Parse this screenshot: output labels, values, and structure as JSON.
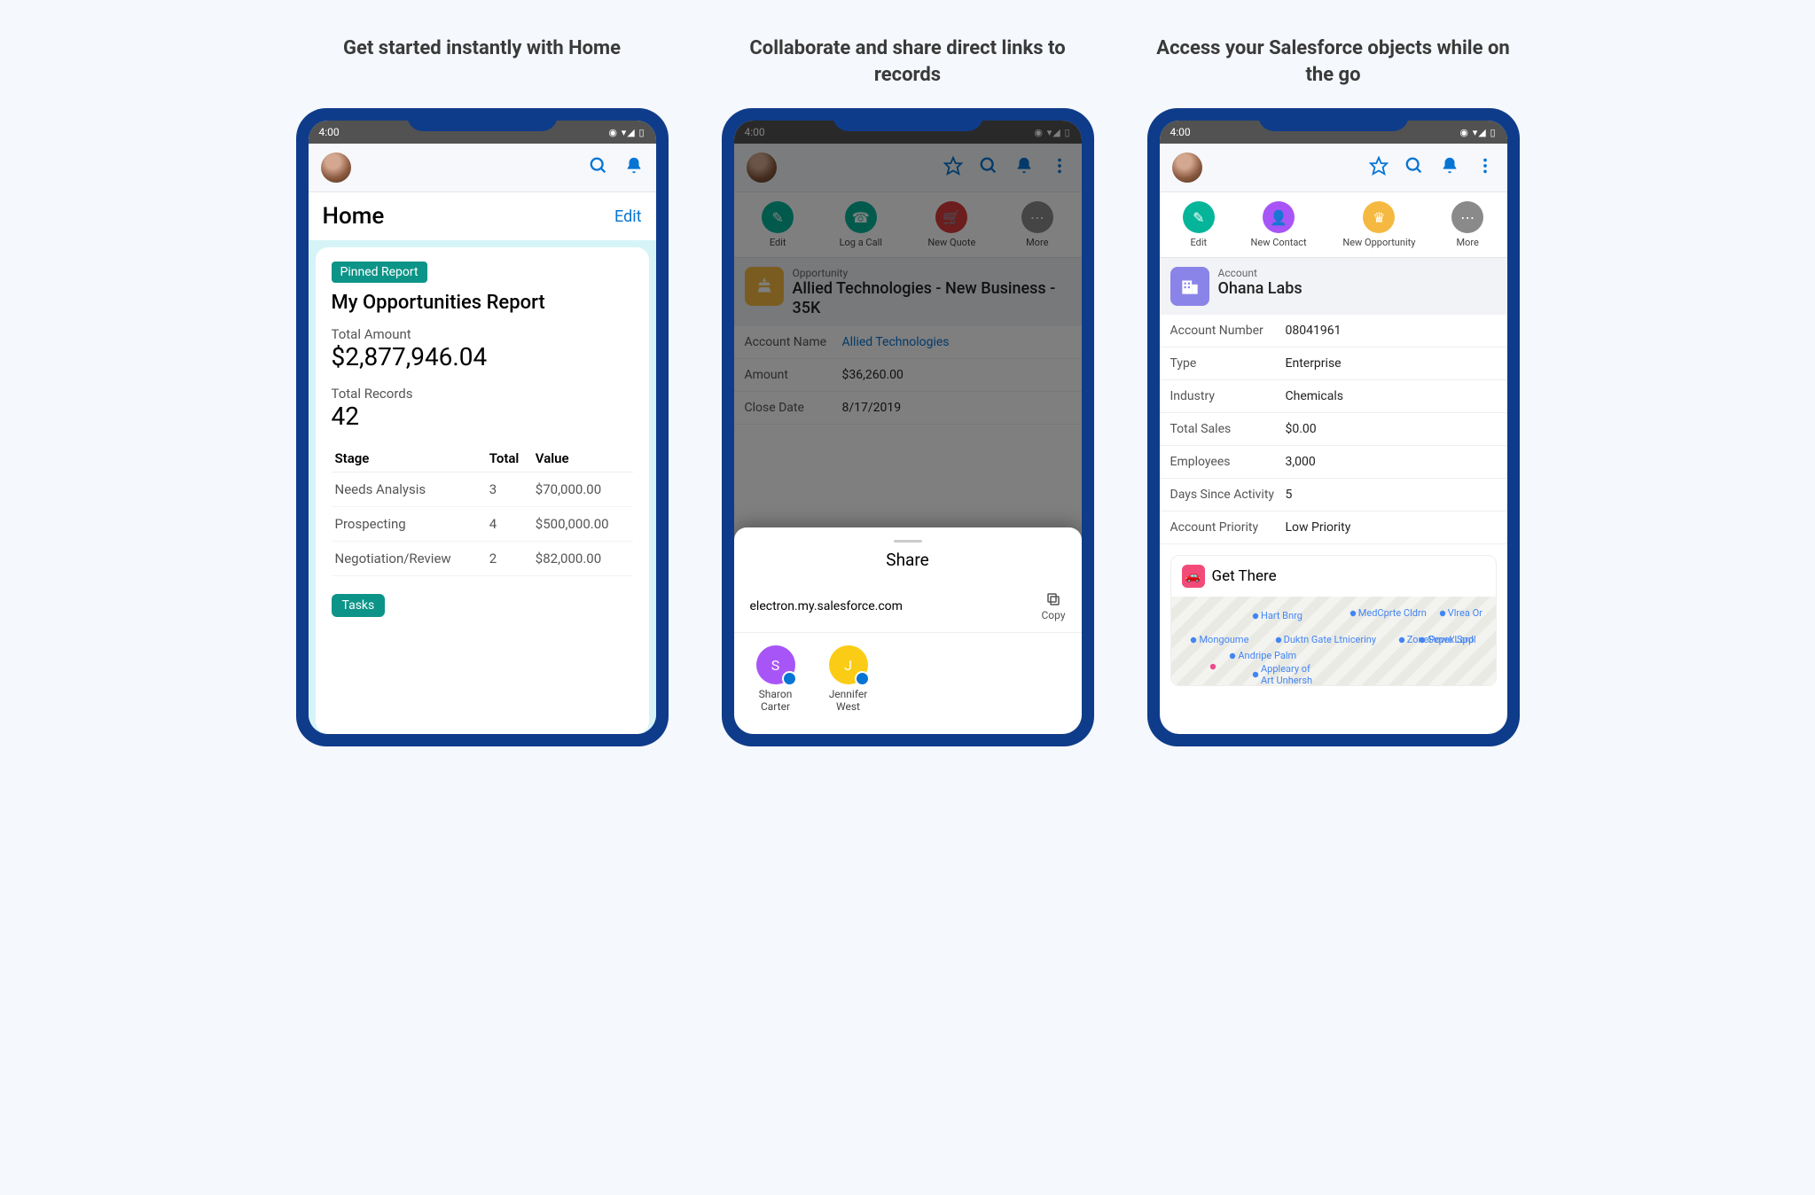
{
  "captions": [
    "Get started instantly with Home",
    "Collaborate and share direct links to records",
    "Access your Salesforce objects while on the go"
  ],
  "status_time": "4:00",
  "phone1": {
    "page_title": "Home",
    "edit": "Edit",
    "pinned_label": "Pinned Report",
    "report_title": "My Opportunities Report",
    "total_amount_label": "Total Amount",
    "total_amount": "$2,877,946.04",
    "total_records_label": "Total Records",
    "total_records": "42",
    "cols": {
      "stage": "Stage",
      "total": "Total",
      "value": "Value"
    },
    "rows": [
      {
        "stage": "Needs Analysis",
        "total": "3",
        "value": "$70,000.00"
      },
      {
        "stage": "Prospecting",
        "total": "4",
        "value": "$500,000.00"
      },
      {
        "stage": "Negotiation/Review",
        "total": "2",
        "value": "$82,000.00"
      }
    ],
    "tasks": "Tasks"
  },
  "phone2": {
    "actions": [
      {
        "label": "Edit",
        "color": "#04b59a"
      },
      {
        "label": "Log a Call",
        "color": "#04b59a"
      },
      {
        "label": "New Quote",
        "color": "#d83a3a"
      },
      {
        "label": "More",
        "color": "#8a8a8a"
      }
    ],
    "record_type": "Opportunity",
    "record_title": "Allied Technologies - New Business - 35K",
    "details": [
      {
        "label": "Account Name",
        "value": "Allied Technologies",
        "link": true
      },
      {
        "label": "Amount",
        "value": "$36,260.00"
      },
      {
        "label": "Close Date",
        "value": "8/17/2019"
      }
    ],
    "share_title": "Share",
    "share_url": "electron.my.salesforce.com",
    "copy_label": "Copy",
    "contacts": [
      {
        "name": "Sharon Carter",
        "initial": "S",
        "color": "#a855f7"
      },
      {
        "name": "Jennifer West",
        "initial": "J",
        "color": "#facc15"
      }
    ]
  },
  "phone3": {
    "actions": [
      {
        "label": "Edit",
        "color": "#04b59a"
      },
      {
        "label": "New Contact",
        "color": "#a855f7"
      },
      {
        "label": "New Opportunity",
        "color": "#f5b941"
      },
      {
        "label": "More",
        "color": "#8a8a8a"
      }
    ],
    "record_type": "Account",
    "record_title": "Ohana Labs",
    "details": [
      {
        "label": "Account Number",
        "value": "08041961"
      },
      {
        "label": "Type",
        "value": "Enterprise"
      },
      {
        "label": "Industry",
        "value": "Chemicals"
      },
      {
        "label": "Total Sales",
        "value": "$0.00"
      },
      {
        "label": "Employees",
        "value": "3,000"
      },
      {
        "label": "Days Since Activity",
        "value": "5"
      },
      {
        "label": "Account Priority",
        "value": "Low Priority"
      }
    ],
    "get_there": "Get There"
  }
}
